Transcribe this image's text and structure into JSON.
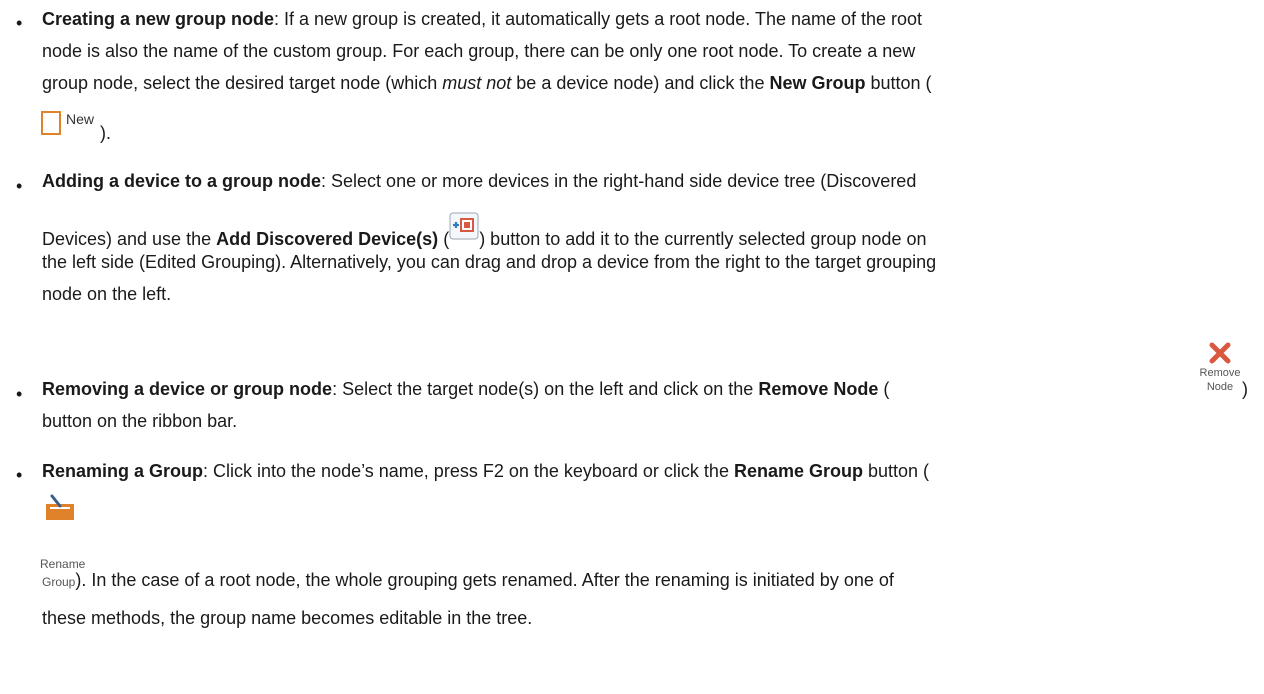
{
  "items": [
    {
      "title": "Creating a new group node",
      "lines": [
        ": If a new group is created, it automatically gets a root node. The name of the root",
        "node is also the name of the custom group. For each group, there can be only one root node. To create a new",
        "group node, select the desired target node (which ",
        "must not",
        " be a device node) and click the ",
        "New Group",
        " button ("
      ],
      "new_icon_label": "New",
      "end": ")."
    },
    {
      "title": "Adding a device to a group node",
      "l1": ": Select one or more devices in the right-hand side device tree (Discovered",
      "l2a": "Devices) and use the ",
      "l2b": "Add Discovered Device(s)",
      "l2c": " (",
      "l2d": ") button to add it to the currently selected group node on",
      "l3": "the left side (Edited Grouping). Alternatively, you can drag and drop a device from the right to the target grouping",
      "l4": "node on the left."
    },
    {
      "title": "Removing a device or group node",
      "l1a": ": Select the target node(s) on the left and click on the ",
      "l1b": "Remove Node",
      "l1c": " (",
      "l1d": " )",
      "icon_l1": "Remove",
      "icon_l2": "Node",
      "l2": "button on the ribbon bar."
    },
    {
      "title": "Renaming a Group",
      "l1a": ": Click into the node’s name, press F2 on the keyboard or click the ",
      "l1b": "Rename Group",
      "l1c": " button (",
      "icon_l1": "Rename",
      "icon_l2": "Group",
      "l2": "). In the case of a root node, the whole grouping gets renamed. After the renaming is initiated by one of",
      "l3": "these methods, the group name becomes editable in the tree."
    }
  ],
  "colors": {
    "text": "#1a1a1a",
    "new_icon_border": "#e0822a",
    "remove_icon": "#d9583f",
    "rename_icon": "#e0822a",
    "add_icon_blue": "#2f7fc0"
  }
}
